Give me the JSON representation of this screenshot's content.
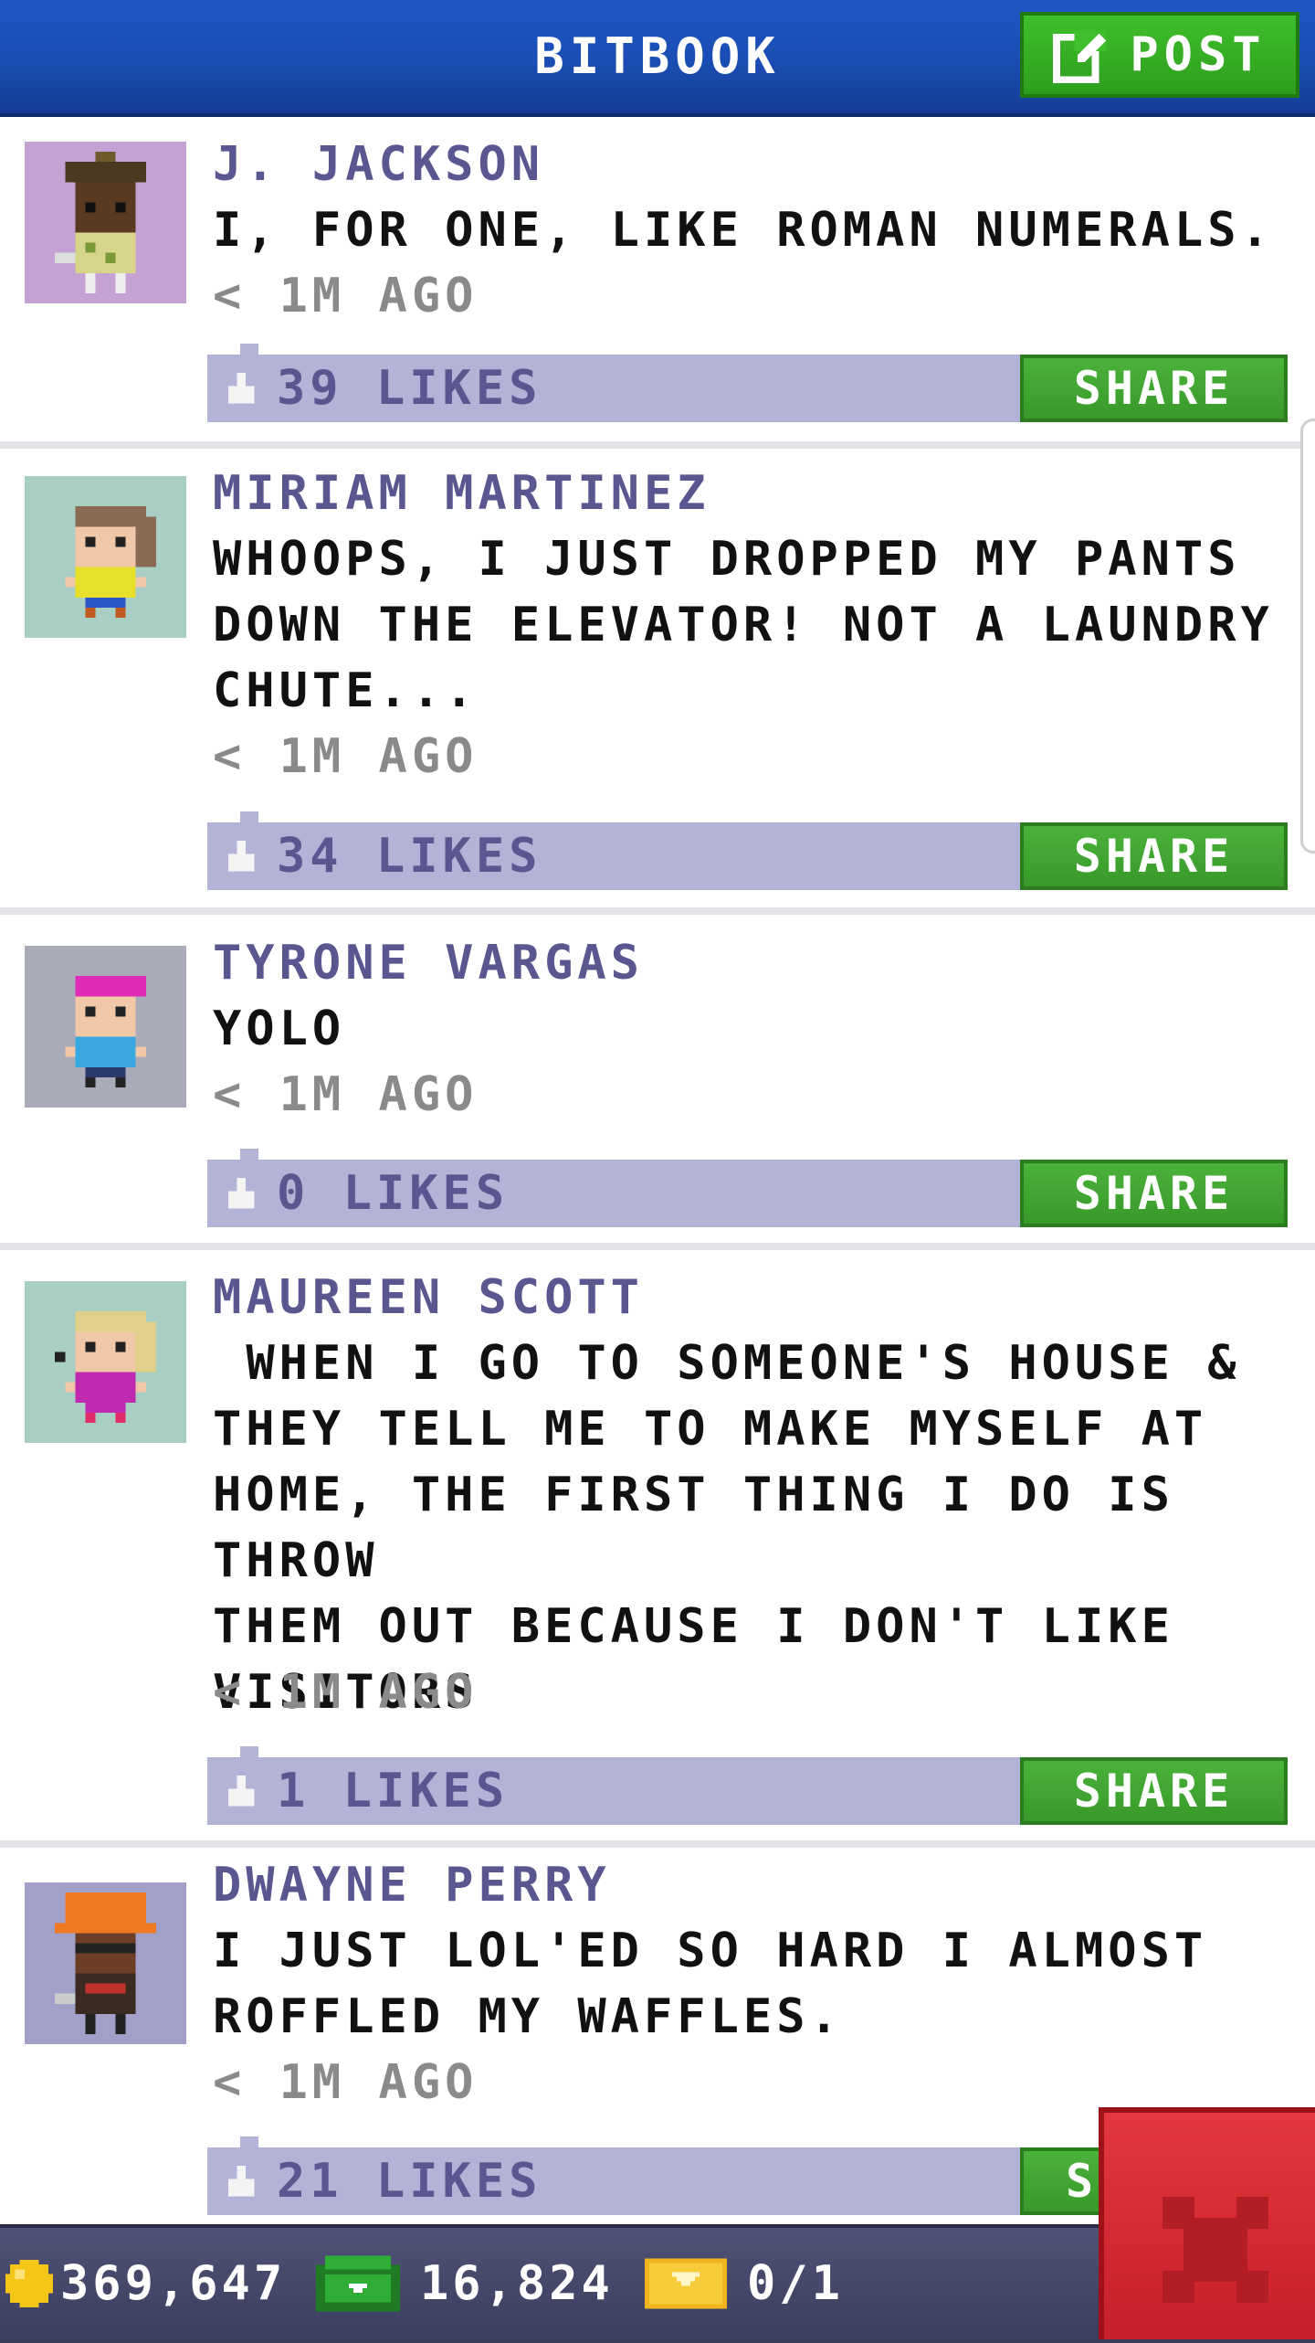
{
  "header": {
    "title": "BITBOOK",
    "post_label": "POST"
  },
  "posts": [
    {
      "author": "J. JACKSON",
      "message": "I, FOR ONE, LIKE ROMAN NUMERALS.",
      "time": "< 1M AGO",
      "likes": "39 LIKES",
      "share_label": "SHARE",
      "avatar_bg": "#c4a2d4"
    },
    {
      "author": "MIRIAM MARTINEZ",
      "message": "WHOOPS, I JUST DROPPED MY PANTS\nDOWN THE ELEVATOR! NOT A LAUNDRY\nCHUTE...",
      "time": "< 1M AGO",
      "likes": "34 LIKES",
      "share_label": "SHARE",
      "avatar_bg": "#a9cfc4"
    },
    {
      "author": "TYRONE VARGAS",
      "message": "YOLO",
      "time": "< 1M AGO",
      "likes": "0 LIKES",
      "share_label": "SHARE",
      "avatar_bg": "#a9abb8"
    },
    {
      "author": "MAUREEN SCOTT",
      "message": " WHEN I GO TO SOMEONE'S HOUSE &\nTHEY TELL ME TO MAKE MYSELF AT\nHOME, THE FIRST THING I DO IS THROW\nTHEM OUT BECAUSE I DON'T LIKE\nVISITORS",
      "time": "< 1M AGO",
      "likes": "1 LIKES",
      "share_label": "SHARE",
      "avatar_bg": "#a9cfc4"
    },
    {
      "author": "DWAYNE PERRY",
      "message": "I JUST LOL'ED SO HARD I ALMOST\nROFFLED MY WAFFLES.",
      "time": "< 1M AGO",
      "likes": "21 LIKES",
      "share_label": "S",
      "avatar_bg": "#a29fc8"
    }
  ],
  "statusbar": {
    "coins": "369,647",
    "bux": "16,824",
    "tickets": "0/1"
  },
  "icons": {
    "post": "edit-icon",
    "like": "thumbs-up-icon",
    "coin": "coin-icon",
    "bux": "bux-icon",
    "ticket": "ticket-icon",
    "close": "close-icon"
  },
  "colors": {
    "header_blue": "#1a4db3",
    "share_green": "#43a734",
    "likes_bar": "#b3b3d7",
    "author_purple": "#5a5690",
    "close_red": "#d42a31"
  }
}
